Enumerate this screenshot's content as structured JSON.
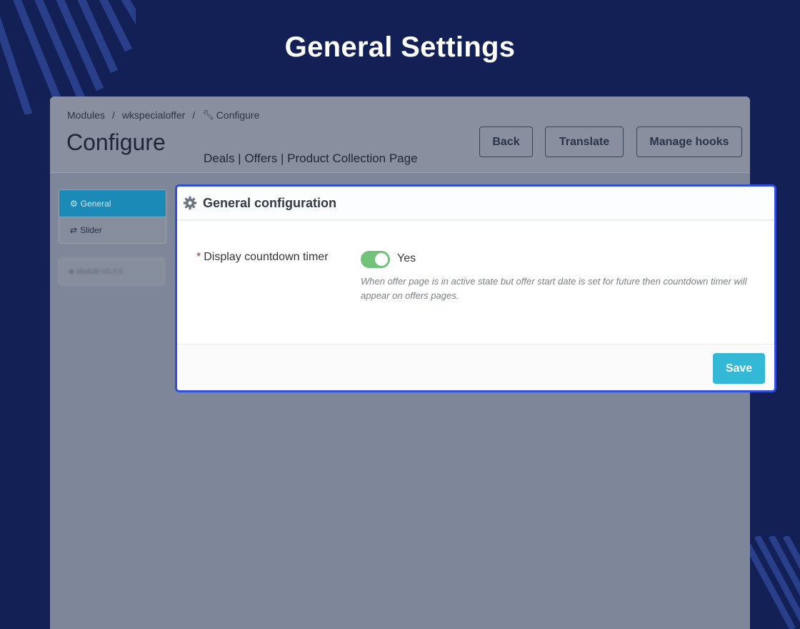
{
  "hero": {
    "title": "General Settings"
  },
  "breadcrumb": {
    "items": [
      "Modules",
      "wkspecialoffer",
      "Configure"
    ],
    "separator": "/"
  },
  "page": {
    "title": "Configure",
    "subtitle": "Deals | Offers | Product Collection Page"
  },
  "toolbar": {
    "back_label": "Back",
    "translate_label": "Translate",
    "hooks_label": "Manage hooks"
  },
  "sidebar": {
    "tabs": [
      {
        "label": "General",
        "icon": "gear-icon",
        "active": true
      },
      {
        "label": "Slider",
        "icon": "exchange-icon",
        "active": false
      }
    ],
    "version_label": "Module V1.2.0"
  },
  "panel": {
    "title": "General configuration",
    "icon": "gear-icon",
    "field": {
      "required_mark": "*",
      "label": "Display countdown timer",
      "value": true,
      "value_label": "Yes",
      "help": "When offer page is in active state but offer start date is set for future then countdown timer will appear on offers pages."
    },
    "save_label": "Save"
  },
  "colors": {
    "background": "#122056",
    "highlight_border": "#2f4fdc",
    "active_tab": "#1b8ab6",
    "switch_on": "#72c279",
    "save_button": "#33b8d6",
    "required": "#c5272e"
  }
}
